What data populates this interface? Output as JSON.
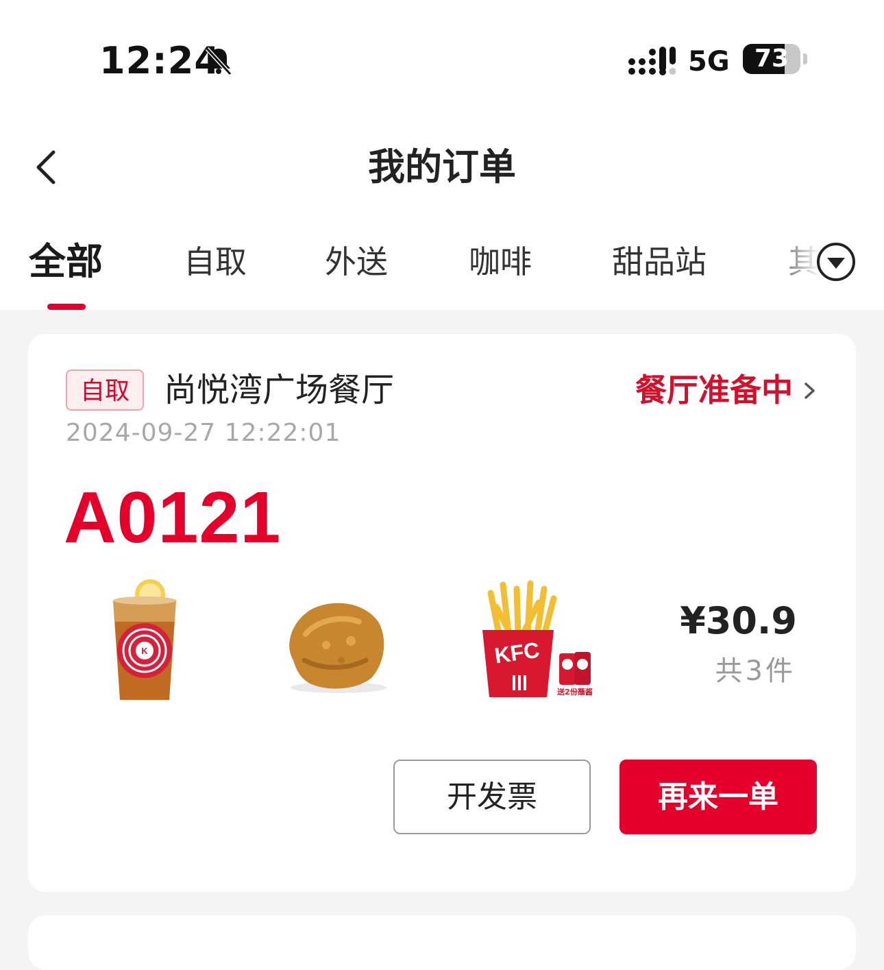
{
  "status_bar": {
    "time": "12:24",
    "network": "5G",
    "battery": "73",
    "battery_level": 0.73,
    "icons": [
      "bell-slash-icon",
      "signal-icon",
      "battery-icon"
    ]
  },
  "header": {
    "back_icon": "chevron-left-icon",
    "title": "我的订单"
  },
  "tabs": [
    {
      "label": "全部",
      "active": true
    },
    {
      "label": "自取",
      "active": false
    },
    {
      "label": "外送",
      "active": false
    },
    {
      "label": "咖啡",
      "active": false
    },
    {
      "label": "甜品站",
      "active": false
    },
    {
      "label": "其",
      "active": false
    }
  ],
  "tabs_more_icon": "dropdown-circle-icon",
  "accent_color": "#e4002b",
  "order": {
    "type_badge": "自取",
    "store_name": "尚悦湾广场餐厅",
    "status": "餐厅准备中",
    "time": "2024-09-27 12:22:01",
    "number": "A0121",
    "products": [
      {
        "name": "lemon-tea-image"
      },
      {
        "name": "fried-chicken-image"
      },
      {
        "name": "fries-image",
        "tag": "送2份蘸酱"
      }
    ],
    "price": "¥30.9",
    "count": "共3件",
    "buttons": {
      "invoice": "开发票",
      "reorder": "再来一单"
    }
  }
}
